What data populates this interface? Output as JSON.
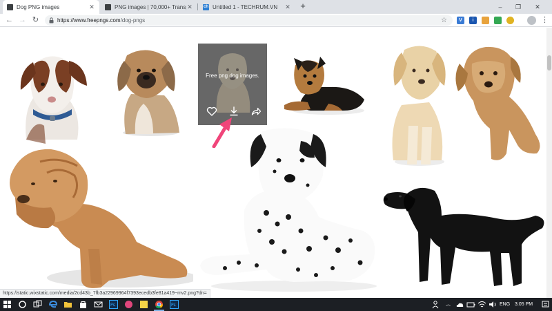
{
  "browser": {
    "tabs": [
      {
        "title": "Dog PNG images",
        "favicon": "freepngs-icon",
        "active": true
      },
      {
        "title": "PNG images | 70,000+ Transpare",
        "favicon": "freepngs-icon",
        "active": false
      },
      {
        "title": "Untitled 1 - TECHRUM.VN",
        "favicon": "ch-icon",
        "favicon_text": "ch",
        "active": false
      }
    ],
    "new_tab_label": "+",
    "window_controls": {
      "minimize": "–",
      "maximize": "❐",
      "close": "✕"
    },
    "toolbar": {
      "back": "←",
      "forward": "→",
      "reload": "↻",
      "url_host": "https://www.freepngs.com",
      "url_path": "/dog-pngs",
      "star": "☆",
      "extensions": [
        {
          "name": "v-extension-icon",
          "label": "V",
          "color": "#3a7bd5"
        },
        {
          "name": "info-extension-icon",
          "label": "i",
          "color": "#1a56b0"
        },
        {
          "name": "sheet-extension-icon",
          "label": "",
          "color": "#e8a33d"
        },
        {
          "name": "check-extension-icon",
          "label": "",
          "color": "#34a853"
        },
        {
          "name": "gear-extension-icon",
          "label": "",
          "color": "#e0b322"
        }
      ],
      "menu": "⋮"
    }
  },
  "page": {
    "hover_caption": "Free png dog images.",
    "hover_actions": [
      "heart-icon",
      "download-icon",
      "share-icon"
    ],
    "status_url": "https://static.wixstatic.com/media/2cd43b_7fb3a22969964f7393ecedb3fe81a419~mv2.png?dn="
  },
  "colors": {
    "accent_pink": "#f0457a",
    "taskbar": "#1c1f24"
  },
  "taskbar": {
    "apps": [
      "windows-start-icon",
      "cortana-search-icon",
      "task-view-icon",
      "edge-icon",
      "file-explorer-icon",
      "store-icon",
      "mail-icon",
      "photoshop-icon",
      "app-icon",
      "sticky-notes-icon",
      "chrome-icon",
      "photoshop-icon-2"
    ],
    "tray": {
      "language": "ENG",
      "time": "3:05 PM"
    }
  }
}
